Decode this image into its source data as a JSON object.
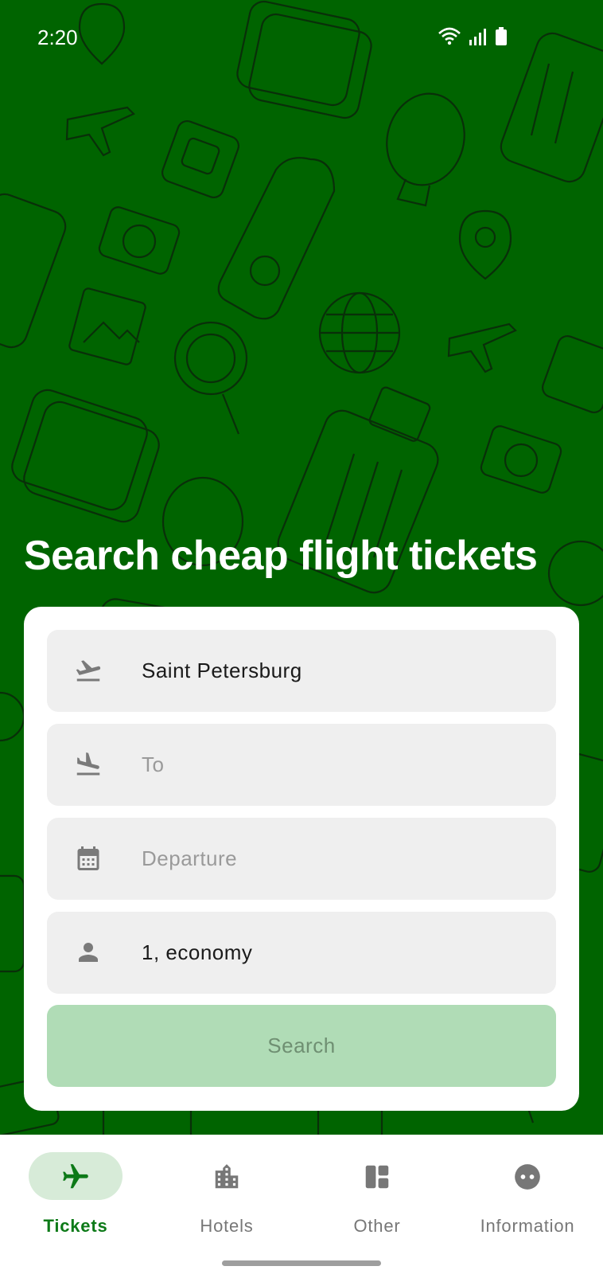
{
  "status_bar": {
    "time": "2:20",
    "icons": [
      "wifi-icon",
      "signal-icon",
      "battery-icon"
    ]
  },
  "headline": "Search cheap flight tickets",
  "form": {
    "from": {
      "value": "Saint Petersburg",
      "icon": "takeoff-icon"
    },
    "to": {
      "placeholder": "To",
      "icon": "landing-icon"
    },
    "departure": {
      "placeholder": "Departure",
      "icon": "calendar-icon"
    },
    "passengers": {
      "value": "1, economy",
      "icon": "person-icon"
    },
    "search_label": "Search"
  },
  "nav": {
    "items": [
      {
        "label": "Tickets",
        "icon": "airplane-icon",
        "active": true
      },
      {
        "label": "Hotels",
        "icon": "building-icon",
        "active": false
      },
      {
        "label": "Other",
        "icon": "dashboard-icon",
        "active": false
      },
      {
        "label": "Information",
        "icon": "info-dots-icon",
        "active": false
      }
    ]
  },
  "colors": {
    "hero_background": "#006400",
    "accent": "#0d7a18",
    "search_button_disabled": "#b0dcb6",
    "field_background": "#efefef"
  }
}
